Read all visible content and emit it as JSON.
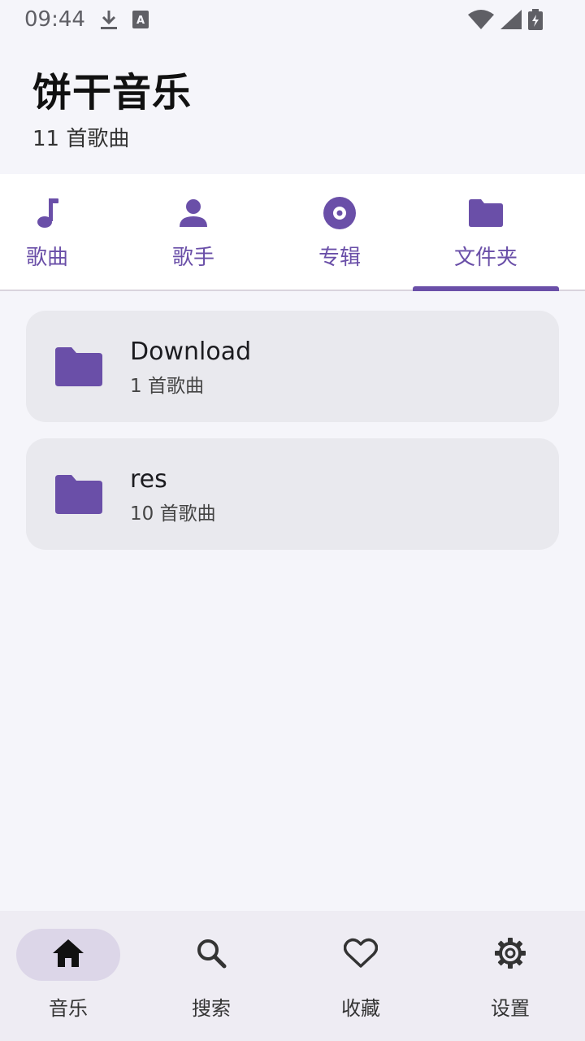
{
  "status_bar": {
    "time": "09:44",
    "icons": [
      "download-icon",
      "keyboard-a-icon",
      "wifi-icon",
      "signal-icon",
      "battery-icon"
    ]
  },
  "header": {
    "title": "饼干音乐",
    "subtitle": "11 首歌曲"
  },
  "tabs": [
    {
      "label": "歌曲",
      "icon": "music-note-icon"
    },
    {
      "label": "歌手",
      "icon": "person-icon"
    },
    {
      "label": "专辑",
      "icon": "album-icon"
    },
    {
      "label": "文件夹",
      "icon": "folder-icon",
      "selected": true
    }
  ],
  "folders": [
    {
      "name": "Download",
      "count": "1 首歌曲"
    },
    {
      "name": "res",
      "count": "10 首歌曲"
    }
  ],
  "bottom_nav": [
    {
      "label": "音乐",
      "icon": "home-icon",
      "active": true
    },
    {
      "label": "搜索",
      "icon": "search-icon"
    },
    {
      "label": "收藏",
      "icon": "heart-icon"
    },
    {
      "label": "设置",
      "icon": "gear-icon"
    }
  ],
  "colors": {
    "accent": "#6a4fa8",
    "background": "#f5f5fa",
    "card": "#e9e9ee",
    "nav_background": "#eeecf3",
    "nav_active_pill": "#dcd6e8"
  }
}
